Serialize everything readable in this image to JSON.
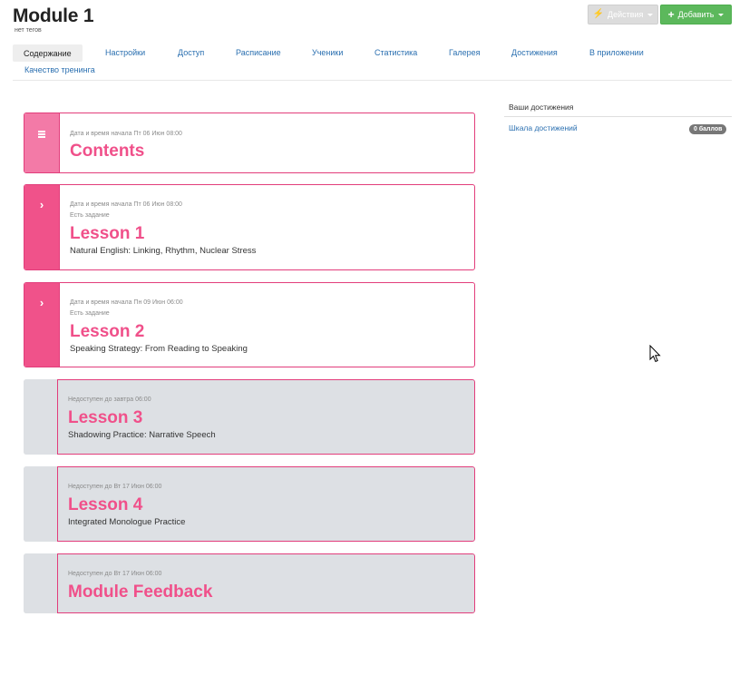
{
  "header": {
    "title": "Module 1",
    "subtitle": "нет тегов",
    "actions_label": "Действия",
    "add_label": "Добавить"
  },
  "tabs": [
    {
      "label": "Содержание",
      "active": true
    },
    {
      "label": "Настройки"
    },
    {
      "label": "Доступ"
    },
    {
      "label": "Расписание"
    },
    {
      "label": "Ученики"
    },
    {
      "label": "Статистика"
    },
    {
      "label": "Галерея"
    },
    {
      "label": "Достижения"
    },
    {
      "label": "В приложении"
    },
    {
      "label": "Качество тренинга"
    }
  ],
  "lessons": [
    {
      "meta1": "Дата и время начала Пт 06 Июн 08:00",
      "title": "Contents",
      "icon": "list-icon"
    },
    {
      "meta1": "Дата и время начала Пт 06 Июн 08:00",
      "meta2": "Есть задание",
      "title": "Lesson 1",
      "desc": "Natural English: Linking, Rhythm, Nuclear Stress",
      "icon": "chevron-right-icon"
    },
    {
      "meta1": "Дата и время начала Пн 09 Июн 06:00",
      "meta2": "Есть задание",
      "title": "Lesson 2",
      "desc": "Speaking Strategy: From Reading to Speaking",
      "icon": "chevron-right-icon"
    },
    {
      "meta1": "Недоступен до завтра 06:00",
      "title": "Lesson 3",
      "desc": "Shadowing Practice: Narrative Speech",
      "locked": true
    },
    {
      "meta1": "Недоступен до Вт 17 Июн 06:00",
      "title": "Lesson 4",
      "desc": "Integrated Monologue Practice",
      "locked": true
    },
    {
      "meta1": "Недоступен до Вт 17 Июн 06:00",
      "title": "Module Feedback",
      "locked": true
    }
  ],
  "achievements": {
    "header": "Ваши достижения",
    "link": "Шкала достижений",
    "badge": "0 баллов"
  },
  "colors": {
    "accent": "#f0508a",
    "add_button": "#5cb85c",
    "link": "#2a6fb0"
  }
}
